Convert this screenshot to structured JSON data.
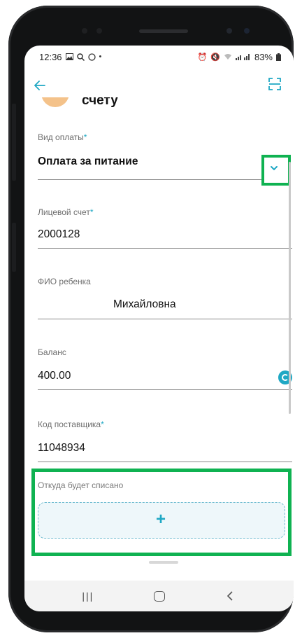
{
  "status_bar": {
    "time": "12:36",
    "left_icons": [
      "image-icon",
      "search-icon",
      "whatsapp-icon",
      "dot-icon"
    ],
    "battery": "83%",
    "right_icons": [
      "alarm-icon",
      "mute-icon",
      "wifi-icon",
      "signal-icon",
      "battery-icon"
    ]
  },
  "header": {
    "partial_title": "счету"
  },
  "form": {
    "payment_type": {
      "label": "Вид оплаты",
      "required_mark": "*",
      "value": "Оплата за питание"
    },
    "account": {
      "label": "Лицевой счет",
      "required_mark": "*",
      "value": "2000128"
    },
    "child_name": {
      "label": "ФИО ребенка",
      "value": "Михайловна"
    },
    "balance": {
      "label": "Баланс",
      "value": "400.00"
    },
    "supplier_code": {
      "label": "Код поставщика",
      "required_mark": "*",
      "value": "11048934"
    },
    "source": {
      "label": "Откуда будет списано",
      "add_symbol": "+"
    }
  },
  "colors": {
    "accent": "#1fa8c4",
    "highlight": "#0fb251"
  }
}
